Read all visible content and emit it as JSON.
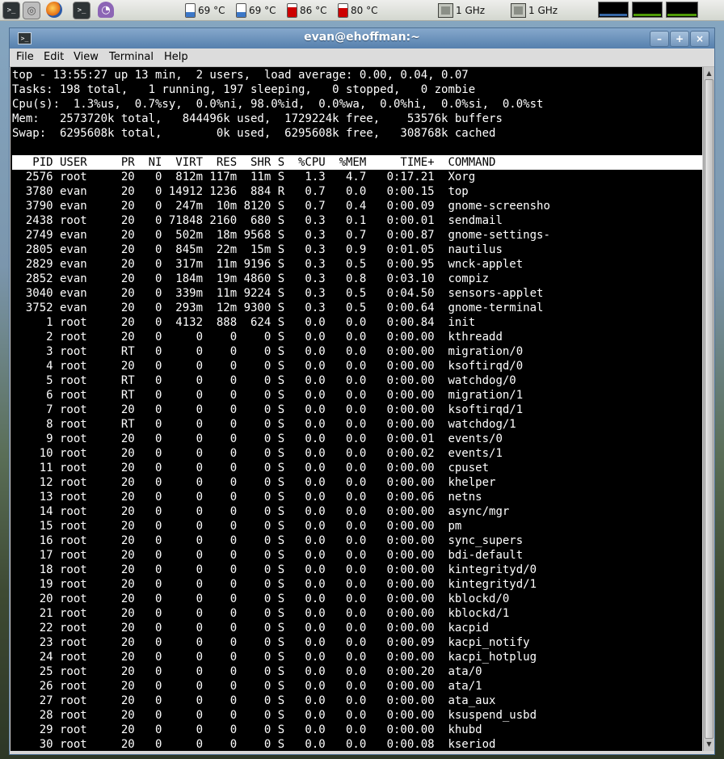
{
  "panel": {
    "launchers": [
      {
        "icon": "terminal-launcher-icon"
      },
      {
        "icon": "help-lifebuoy-icon"
      },
      {
        "icon": "firefox-icon"
      },
      {
        "icon": "terminal-icon"
      },
      {
        "icon": "pidgin-icon"
      }
    ],
    "sensors": [
      {
        "label": "69 °C",
        "color": "#3c78c8",
        "fill": 0.35
      },
      {
        "label": "69 °C",
        "color": "#3c78c8",
        "fill": 0.35
      },
      {
        "label": "86 °C",
        "color": "#cc0000",
        "fill": 0.75
      },
      {
        "label": "80 °C",
        "color": "#cc0000",
        "fill": 0.7
      }
    ],
    "cpufreq": [
      {
        "label": "1 GHz"
      },
      {
        "label": "1 GHz"
      }
    ],
    "sysmon_colors": [
      "#3465a4",
      "#4e9a06",
      "#4e9a06",
      "#204a87"
    ]
  },
  "window": {
    "title": "evan@ehoffman:~",
    "buttons": {
      "minimize": "–",
      "maximize": "+",
      "close": "×"
    },
    "menu": [
      "File",
      "Edit",
      "View",
      "Terminal",
      "Help"
    ]
  },
  "top": {
    "summary": [
      "top - 13:55:27 up 13 min,  2 users,  load average: 0.00, 0.04, 0.07",
      "Tasks: 198 total,   1 running, 197 sleeping,   0 stopped,   0 zombie",
      "Cpu(s):  1.3%us,  0.7%sy,  0.0%ni, 98.0%id,  0.0%wa,  0.0%hi,  0.0%si,  0.0%st",
      "Mem:   2573720k total,   844496k used,  1729224k free,    53576k buffers",
      "Swap:  6295608k total,        0k used,  6295608k free,   308768k cached"
    ],
    "columns": [
      "PID",
      "USER",
      "PR",
      "NI",
      "VIRT",
      "RES",
      "SHR",
      "S",
      "%CPU",
      "%MEM",
      "TIME+",
      "COMMAND"
    ],
    "processes": [
      [
        "2576",
        "root",
        "20",
        "0",
        "812m",
        "117m",
        "11m",
        "S",
        "1.3",
        "4.7",
        "0:17.21",
        "Xorg"
      ],
      [
        "3780",
        "evan",
        "20",
        "0",
        "14912",
        "1236",
        "884",
        "R",
        "0.7",
        "0.0",
        "0:00.15",
        "top"
      ],
      [
        "3790",
        "evan",
        "20",
        "0",
        "247m",
        "10m",
        "8120",
        "S",
        "0.7",
        "0.4",
        "0:00.09",
        "gnome-screensho"
      ],
      [
        "2438",
        "root",
        "20",
        "0",
        "71848",
        "2160",
        "680",
        "S",
        "0.3",
        "0.1",
        "0:00.01",
        "sendmail"
      ],
      [
        "2749",
        "evan",
        "20",
        "0",
        "502m",
        "18m",
        "9568",
        "S",
        "0.3",
        "0.7",
        "0:00.87",
        "gnome-settings-"
      ],
      [
        "2805",
        "evan",
        "20",
        "0",
        "845m",
        "22m",
        "15m",
        "S",
        "0.3",
        "0.9",
        "0:01.05",
        "nautilus"
      ],
      [
        "2829",
        "evan",
        "20",
        "0",
        "317m",
        "11m",
        "9196",
        "S",
        "0.3",
        "0.5",
        "0:00.95",
        "wnck-applet"
      ],
      [
        "2852",
        "evan",
        "20",
        "0",
        "184m",
        "19m",
        "4860",
        "S",
        "0.3",
        "0.8",
        "0:03.10",
        "compiz"
      ],
      [
        "3040",
        "evan",
        "20",
        "0",
        "339m",
        "11m",
        "9224",
        "S",
        "0.3",
        "0.5",
        "0:04.50",
        "sensors-applet"
      ],
      [
        "3752",
        "evan",
        "20",
        "0",
        "293m",
        "12m",
        "9300",
        "S",
        "0.3",
        "0.5",
        "0:00.64",
        "gnome-terminal"
      ],
      [
        "1",
        "root",
        "20",
        "0",
        "4132",
        "888",
        "624",
        "S",
        "0.0",
        "0.0",
        "0:00.84",
        "init"
      ],
      [
        "2",
        "root",
        "20",
        "0",
        "0",
        "0",
        "0",
        "S",
        "0.0",
        "0.0",
        "0:00.00",
        "kthreadd"
      ],
      [
        "3",
        "root",
        "RT",
        "0",
        "0",
        "0",
        "0",
        "S",
        "0.0",
        "0.0",
        "0:00.00",
        "migration/0"
      ],
      [
        "4",
        "root",
        "20",
        "0",
        "0",
        "0",
        "0",
        "S",
        "0.0",
        "0.0",
        "0:00.00",
        "ksoftirqd/0"
      ],
      [
        "5",
        "root",
        "RT",
        "0",
        "0",
        "0",
        "0",
        "S",
        "0.0",
        "0.0",
        "0:00.00",
        "watchdog/0"
      ],
      [
        "6",
        "root",
        "RT",
        "0",
        "0",
        "0",
        "0",
        "S",
        "0.0",
        "0.0",
        "0:00.00",
        "migration/1"
      ],
      [
        "7",
        "root",
        "20",
        "0",
        "0",
        "0",
        "0",
        "S",
        "0.0",
        "0.0",
        "0:00.00",
        "ksoftirqd/1"
      ],
      [
        "8",
        "root",
        "RT",
        "0",
        "0",
        "0",
        "0",
        "S",
        "0.0",
        "0.0",
        "0:00.00",
        "watchdog/1"
      ],
      [
        "9",
        "root",
        "20",
        "0",
        "0",
        "0",
        "0",
        "S",
        "0.0",
        "0.0",
        "0:00.01",
        "events/0"
      ],
      [
        "10",
        "root",
        "20",
        "0",
        "0",
        "0",
        "0",
        "S",
        "0.0",
        "0.0",
        "0:00.02",
        "events/1"
      ],
      [
        "11",
        "root",
        "20",
        "0",
        "0",
        "0",
        "0",
        "S",
        "0.0",
        "0.0",
        "0:00.00",
        "cpuset"
      ],
      [
        "12",
        "root",
        "20",
        "0",
        "0",
        "0",
        "0",
        "S",
        "0.0",
        "0.0",
        "0:00.00",
        "khelper"
      ],
      [
        "13",
        "root",
        "20",
        "0",
        "0",
        "0",
        "0",
        "S",
        "0.0",
        "0.0",
        "0:00.06",
        "netns"
      ],
      [
        "14",
        "root",
        "20",
        "0",
        "0",
        "0",
        "0",
        "S",
        "0.0",
        "0.0",
        "0:00.00",
        "async/mgr"
      ],
      [
        "15",
        "root",
        "20",
        "0",
        "0",
        "0",
        "0",
        "S",
        "0.0",
        "0.0",
        "0:00.00",
        "pm"
      ],
      [
        "16",
        "root",
        "20",
        "0",
        "0",
        "0",
        "0",
        "S",
        "0.0",
        "0.0",
        "0:00.00",
        "sync_supers"
      ],
      [
        "17",
        "root",
        "20",
        "0",
        "0",
        "0",
        "0",
        "S",
        "0.0",
        "0.0",
        "0:00.00",
        "bdi-default"
      ],
      [
        "18",
        "root",
        "20",
        "0",
        "0",
        "0",
        "0",
        "S",
        "0.0",
        "0.0",
        "0:00.00",
        "kintegrityd/0"
      ],
      [
        "19",
        "root",
        "20",
        "0",
        "0",
        "0",
        "0",
        "S",
        "0.0",
        "0.0",
        "0:00.00",
        "kintegrityd/1"
      ],
      [
        "20",
        "root",
        "20",
        "0",
        "0",
        "0",
        "0",
        "S",
        "0.0",
        "0.0",
        "0:00.00",
        "kblockd/0"
      ],
      [
        "21",
        "root",
        "20",
        "0",
        "0",
        "0",
        "0",
        "S",
        "0.0",
        "0.0",
        "0:00.00",
        "kblockd/1"
      ],
      [
        "22",
        "root",
        "20",
        "0",
        "0",
        "0",
        "0",
        "S",
        "0.0",
        "0.0",
        "0:00.00",
        "kacpid"
      ],
      [
        "23",
        "root",
        "20",
        "0",
        "0",
        "0",
        "0",
        "S",
        "0.0",
        "0.0",
        "0:00.09",
        "kacpi_notify"
      ],
      [
        "24",
        "root",
        "20",
        "0",
        "0",
        "0",
        "0",
        "S",
        "0.0",
        "0.0",
        "0:00.00",
        "kacpi_hotplug"
      ],
      [
        "25",
        "root",
        "20",
        "0",
        "0",
        "0",
        "0",
        "S",
        "0.0",
        "0.0",
        "0:00.20",
        "ata/0"
      ],
      [
        "26",
        "root",
        "20",
        "0",
        "0",
        "0",
        "0",
        "S",
        "0.0",
        "0.0",
        "0:00.00",
        "ata/1"
      ],
      [
        "27",
        "root",
        "20",
        "0",
        "0",
        "0",
        "0",
        "S",
        "0.0",
        "0.0",
        "0:00.00",
        "ata_aux"
      ],
      [
        "28",
        "root",
        "20",
        "0",
        "0",
        "0",
        "0",
        "S",
        "0.0",
        "0.0",
        "0:00.00",
        "ksuspend_usbd"
      ],
      [
        "29",
        "root",
        "20",
        "0",
        "0",
        "0",
        "0",
        "S",
        "0.0",
        "0.0",
        "0:00.00",
        "khubd"
      ],
      [
        "30",
        "root",
        "20",
        "0",
        "0",
        "0",
        "0",
        "S",
        "0.0",
        "0.0",
        "0:00.08",
        "kseriod"
      ]
    ]
  }
}
